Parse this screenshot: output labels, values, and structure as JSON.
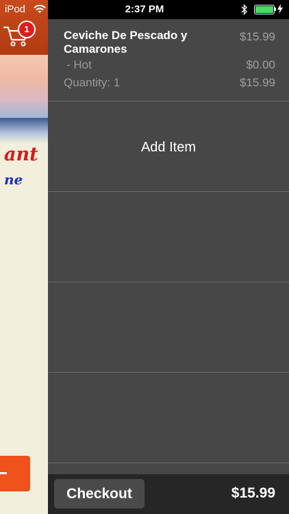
{
  "status_bar": {
    "carrier": "iPod",
    "time": "2:37 PM",
    "battery_level": 1.0,
    "battery_color": "#4cd964",
    "icons": [
      "wifi-icon",
      "bluetooth-icon",
      "battery-icon",
      "charging-bolt-icon"
    ]
  },
  "background_app": {
    "cart_badge": "1",
    "cart_icon": "shopping-cart-icon",
    "header_color": "#c2421a",
    "brand_text_line1": "ant",
    "brand_text_line2": "ne"
  },
  "cart": {
    "items": [
      {
        "name": "Ceviche De Pescado y Camarones",
        "price": "$15.99",
        "modifiers": [
          {
            "name": "- Hot",
            "price": "$0.00"
          }
        ],
        "quantity_label": "Quantity: 1",
        "line_total": "$15.99"
      }
    ],
    "add_item_label": "Add Item"
  },
  "footer": {
    "checkout_label": "Checkout",
    "total": "$15.99"
  }
}
